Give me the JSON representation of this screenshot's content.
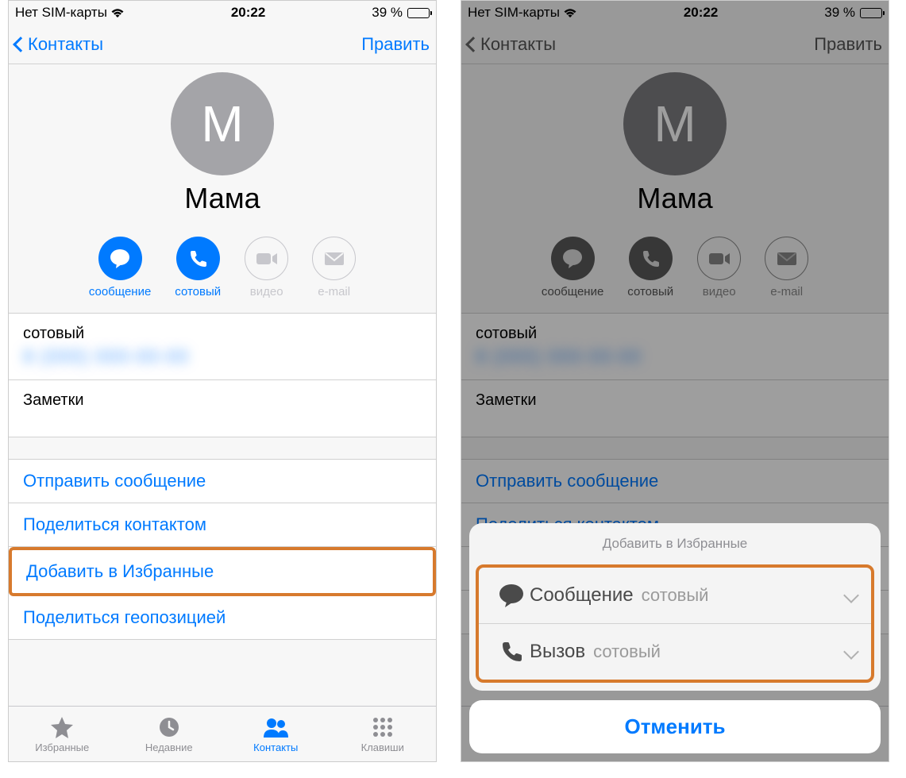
{
  "status": {
    "carrier": "Нет SIM-карты",
    "time": "20:22",
    "battery_pct": "39 %"
  },
  "nav": {
    "back": "Контакты",
    "edit": "Править"
  },
  "contact": {
    "initial": "М",
    "name": "Мама"
  },
  "actions": {
    "message": "сообщение",
    "cell": "сотовый",
    "video": "видео",
    "email": "e-mail"
  },
  "fields": {
    "phone_label": "сотовый",
    "phone_value_masked": "8 (000) 000-00-00",
    "notes_label": "Заметки"
  },
  "links": {
    "send_message": "Отправить сообщение",
    "share_contact": "Поделиться контактом",
    "add_favorite": "Добавить в Избранные",
    "share_location": "Поделиться геопозицией"
  },
  "tabs": {
    "favorites": "Избранные",
    "recents": "Недавние",
    "contacts": "Контакты",
    "keypad": "Клавиши"
  },
  "sheet": {
    "title": "Добавить в Избранные",
    "option_message": "Сообщение",
    "option_message_sub": "сотовый",
    "option_call": "Вызов",
    "option_call_sub": "сотовый",
    "cancel": "Отменить"
  }
}
